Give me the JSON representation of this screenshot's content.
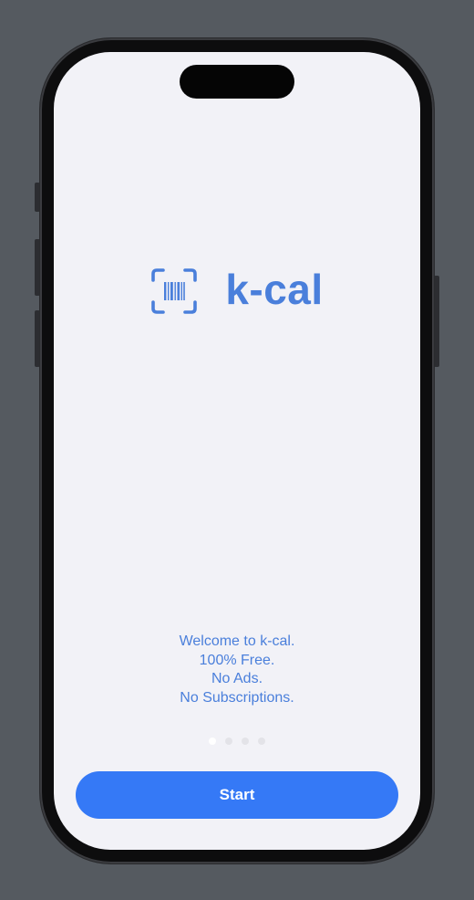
{
  "app": {
    "name": "k-cal",
    "accent_color": "#4a7fdb",
    "button_color": "#3579f6",
    "background_color": "#f2f2f7"
  },
  "logo": {
    "icon": "barcode-scanner-icon",
    "text": "k-cal"
  },
  "welcome": {
    "lines": [
      "Welcome to k-cal.",
      "100% Free.",
      "No Ads.",
      "No Subscriptions."
    ]
  },
  "pager": {
    "total_pages": 4,
    "current_page": 1
  },
  "start_button": {
    "label": "Start"
  }
}
